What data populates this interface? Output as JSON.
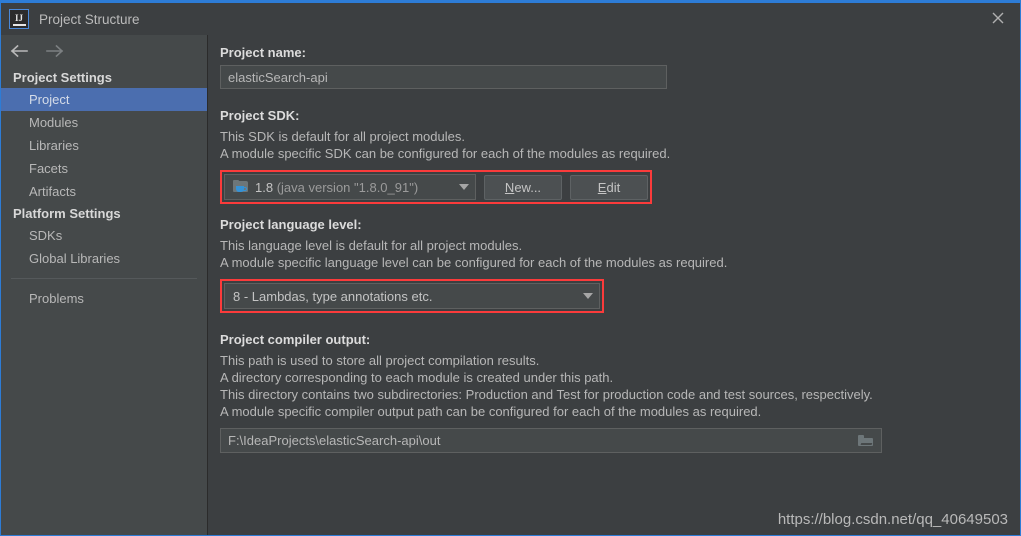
{
  "window": {
    "title": "Project Structure",
    "logo_letters": "IJ",
    "close_icon": "close-icon"
  },
  "nav": {
    "back_icon": "arrow-left-icon",
    "forward_icon": "arrow-right-icon"
  },
  "sidebar": {
    "groups": [
      {
        "title": "Project Settings",
        "items": [
          {
            "label": "Project",
            "selected": true
          },
          {
            "label": "Modules",
            "selected": false
          },
          {
            "label": "Libraries",
            "selected": false
          },
          {
            "label": "Facets",
            "selected": false
          },
          {
            "label": "Artifacts",
            "selected": false
          }
        ]
      },
      {
        "title": "Platform Settings",
        "items": [
          {
            "label": "SDKs",
            "selected": false
          },
          {
            "label": "Global Libraries",
            "selected": false
          }
        ]
      }
    ],
    "footer_items": [
      {
        "label": "Problems"
      }
    ]
  },
  "main": {
    "project_name": {
      "label": "Project name:",
      "value": "elasticSearch-api"
    },
    "project_sdk": {
      "label": "Project SDK:",
      "description_line1": "This SDK is default for all project modules.",
      "description_line2": "A module specific SDK can be configured for each of the modules as required.",
      "selected_version": "1.8",
      "selected_detail": "(java version \"1.8.0_91\")",
      "icon": "java-sdk-folder-icon",
      "new_button": "New...",
      "new_button_mnemonic": "N",
      "edit_button": "Edit",
      "edit_button_mnemonic": "E",
      "highlighted": true
    },
    "language_level": {
      "label": "Project language level:",
      "description_line1": "This language level is default for all project modules.",
      "description_line2": "A module specific language level can be configured for each of the modules as required.",
      "selected": "8 - Lambdas, type annotations etc.",
      "highlighted": true
    },
    "compiler_output": {
      "label": "Project compiler output:",
      "description_line1": "This path is used to store all project compilation results.",
      "description_line2": "A directory corresponding to each module is created under this path.",
      "description_line3": "This directory contains two subdirectories: Production and Test for production code and test sources, respectively.",
      "description_line4": "A module specific compiler output path can be configured for each of the modules as required.",
      "value": "F:\\IdeaProjects\\elasticSearch-api\\out",
      "browse_icon": "folder-icon"
    }
  },
  "watermark": "https://blog.csdn.net/qq_40649503",
  "colors": {
    "window_bg": "#3c3f41",
    "sidebar_bg": "#45494a",
    "accent_border": "#2d7cd6",
    "selection": "#4b6eaf",
    "highlight_red": "#fb3b3b",
    "text": "#b7b7b7",
    "text_bold": "#dcdcdc"
  }
}
